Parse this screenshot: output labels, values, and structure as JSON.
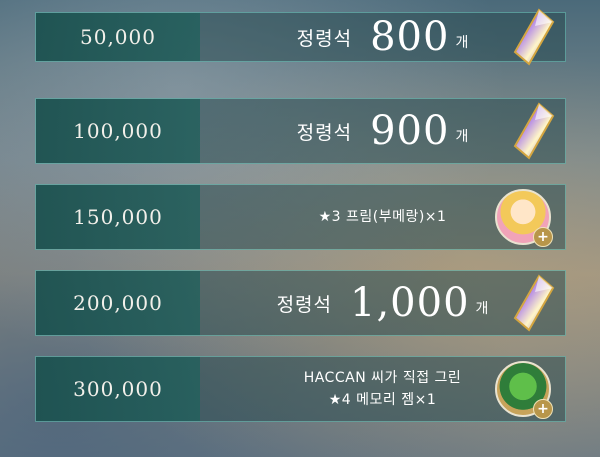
{
  "rows": [
    {
      "amount": "50,000",
      "word": "정령석",
      "count": "800",
      "unit": "개",
      "icon": "spirit-stone-crystal-icon"
    },
    {
      "amount": "100,000",
      "word": "정령석",
      "count": "900",
      "unit": "개",
      "icon": "spirit-stone-crystal-icon"
    },
    {
      "amount": "150,000",
      "text": "★3 프림(부메랑)×1",
      "icon": "prim-character-avatar-icon"
    },
    {
      "amount": "200,000",
      "word": "정령석",
      "count": "1,000",
      "unit": "개",
      "icon": "spirit-stone-crystal-icon"
    },
    {
      "amount": "300,000",
      "text_line1": "HACCAN 씨가 직접 그린",
      "text_line2": "★4 메모리 젬×1",
      "icon": "memory-gem-avatar-icon"
    }
  ],
  "colors": {
    "amount_bg": "#1c5250",
    "border": "#6ec8be",
    "plus_badge": "#b8964a"
  }
}
